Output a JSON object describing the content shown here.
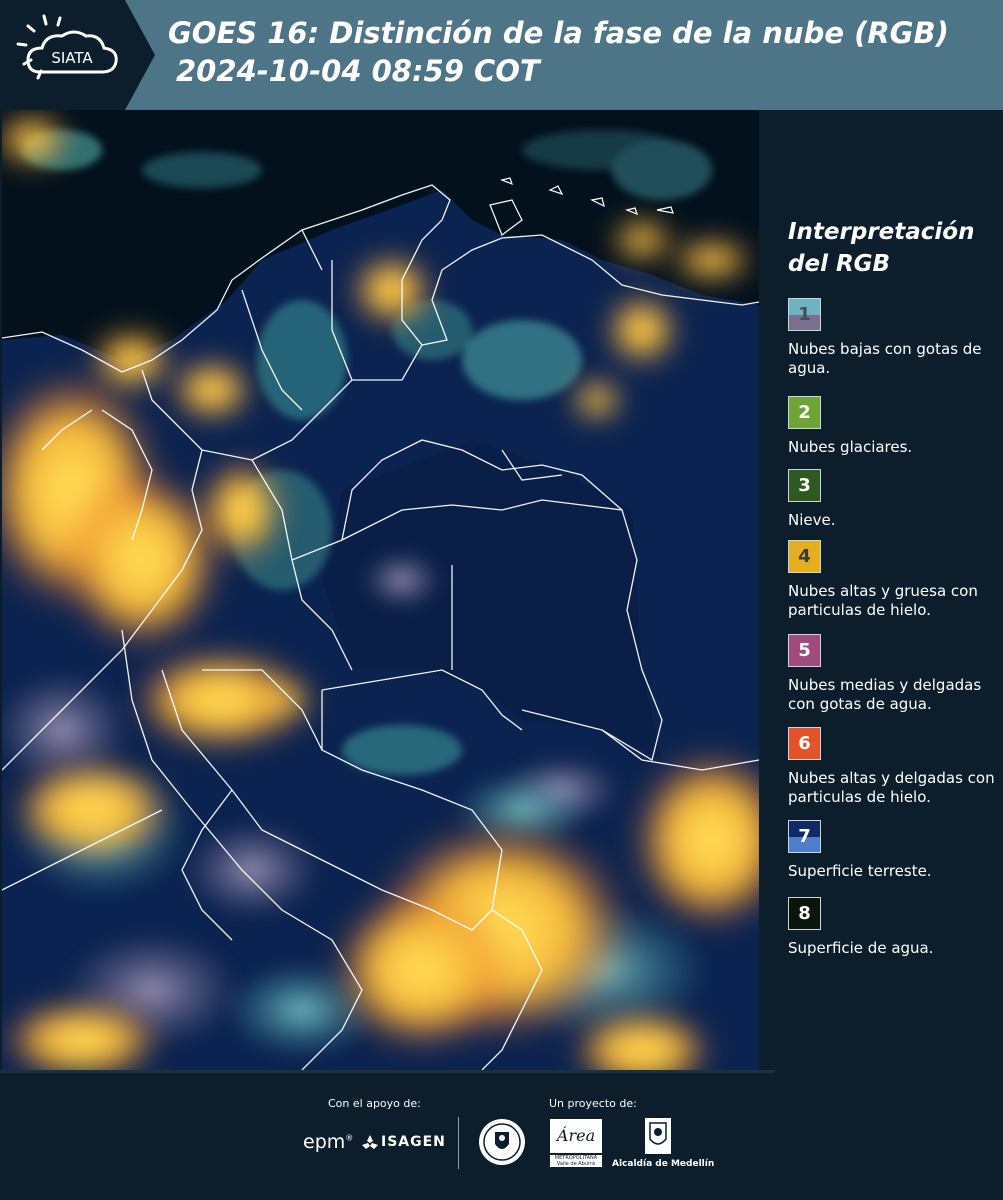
{
  "header": {
    "logo_text": "SIATA",
    "title_line1": "GOES 16: Distinción de la fase de la nube (RGB)",
    "title_line2": "2024-10-04 08:59 COT",
    "background_color": "#4e7587"
  },
  "map": {
    "content": "goes16-cloud-phase-rgb-colombia"
  },
  "legend": {
    "title": "Interpretación del RGB",
    "items": [
      {
        "num": "1",
        "label": "Nubes bajas con gotas de agua.",
        "color_top": "#6fb3c3",
        "color_bottom": "#7a6f8f",
        "num_color": "#4a4a5a"
      },
      {
        "num": "2",
        "label": "Nubes glaciares.",
        "color": "#6ea336",
        "num_color": "#ffffff"
      },
      {
        "num": "3",
        "label": "Nieve.",
        "color": "#2e5a22",
        "num_color": "#ffffff"
      },
      {
        "num": "4",
        "label": "Nubes altas y gruesa con particulas de hielo.",
        "color": "#e5ad1f",
        "num_color": "#3a3a3a"
      },
      {
        "num": "5",
        "label": "Nubes medias y delgadas con gotas de agua.",
        "color": "#a04a7e",
        "num_color": "#ffffff"
      },
      {
        "num": "6",
        "label": "Nubes altas y delgadas con particulas de hielo.",
        "color": "#e2522b",
        "num_color": "#ffffff"
      },
      {
        "num": "7",
        "label": "Superficie terreste.",
        "color_top": "#0f2a66",
        "color_bottom": "#4d7ecb",
        "num_color": "#ffffff"
      },
      {
        "num": "8",
        "label": "Superficie de agua.",
        "color": "#0a150d",
        "num_color": "#ffffff"
      }
    ]
  },
  "footer": {
    "support_label": "Con el apoyo de:",
    "project_label": "Un proyecto de:",
    "epm_logo": "epm",
    "isagen_logo": "ISAGEN",
    "metro_logo_line1": "METROPOLITANA",
    "metro_logo_line2": "Valle de Aburrá",
    "alcaldia_logo": "Alcaldía de Medellín"
  }
}
